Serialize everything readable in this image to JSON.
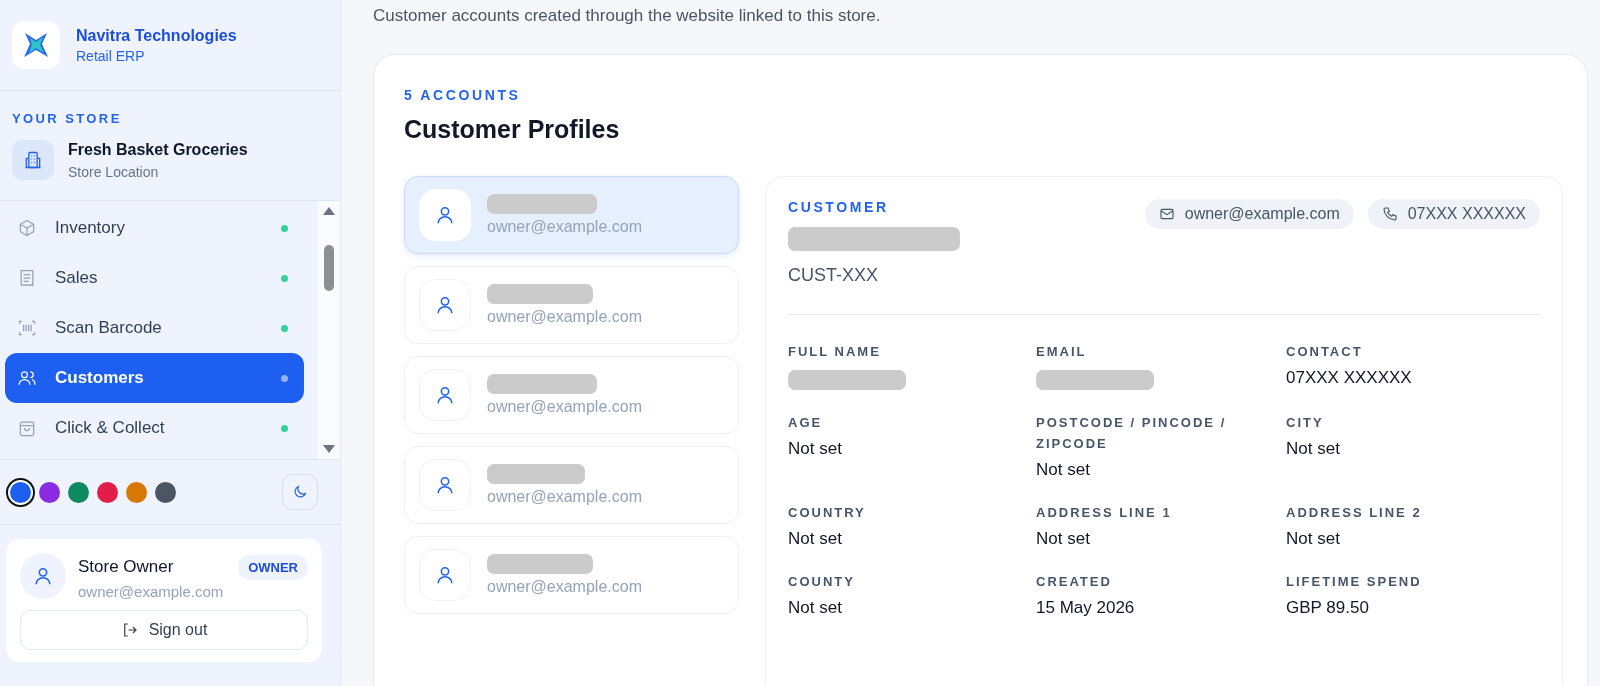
{
  "brand": {
    "name": "Navitra Technologies",
    "subtitle": "Retail ERP"
  },
  "store": {
    "heading": "YOUR STORE",
    "name": "Fresh Basket Groceries",
    "location": "Store Location"
  },
  "nav": [
    {
      "label": "Inventory",
      "selected": false
    },
    {
      "label": "Sales",
      "selected": false
    },
    {
      "label": "Scan Barcode",
      "selected": false
    },
    {
      "label": "Customers",
      "selected": true
    },
    {
      "label": "Click & Collect",
      "selected": false
    }
  ],
  "theme_colors": [
    {
      "color": "#1d5ff0",
      "selected": true
    },
    {
      "color": "#8a2be2",
      "selected": false
    },
    {
      "color": "#0e8a5f",
      "selected": false
    },
    {
      "color": "#e11d48",
      "selected": false
    },
    {
      "color": "#d97706",
      "selected": false
    },
    {
      "color": "#4b5563",
      "selected": false
    }
  ],
  "user": {
    "name": "Store Owner",
    "role": "OWNER",
    "email": "owner@example.com",
    "sign_out": "Sign out"
  },
  "intro": "Customer accounts created through the website linked to this store.",
  "profiles": {
    "count": "5 ACCOUNTS",
    "title": "Customer Profiles",
    "customers": [
      {
        "email": "owner@example.com",
        "selected": true
      },
      {
        "email": "owner@example.com",
        "selected": false
      },
      {
        "email": "owner@example.com",
        "selected": false
      },
      {
        "email": "owner@example.com",
        "selected": false
      },
      {
        "email": "owner@example.com",
        "selected": false
      }
    ]
  },
  "detail": {
    "heading": "CUSTOMER",
    "id": "CUST-XXX",
    "email": "owner@example.com",
    "phone": "07XXX XXXXXX",
    "fields": [
      {
        "label": "FULL NAME",
        "kind": "redacted"
      },
      {
        "label": "EMAIL",
        "kind": "redacted"
      },
      {
        "label": "CONTACT",
        "kind": "text",
        "value": "07XXX XXXXXX"
      },
      {
        "label": "AGE",
        "kind": "text",
        "value": "Not set"
      },
      {
        "label": "POSTCODE / PINCODE / ZIPCODE",
        "kind": "text",
        "value": "Not set"
      },
      {
        "label": "CITY",
        "kind": "text",
        "value": "Not set"
      },
      {
        "label": "COUNTRY",
        "kind": "text",
        "value": "Not set"
      },
      {
        "label": "ADDRESS LINE 1",
        "kind": "text",
        "value": "Not set"
      },
      {
        "label": "ADDRESS LINE 2",
        "kind": "text",
        "value": "Not set"
      },
      {
        "label": "COUNTY",
        "kind": "text",
        "value": "Not set"
      },
      {
        "label": "CREATED",
        "kind": "text",
        "value": "15 May 2026"
      },
      {
        "label": "LIFETIME SPEND",
        "kind": "text",
        "value": "GBP 89.50"
      }
    ]
  }
}
